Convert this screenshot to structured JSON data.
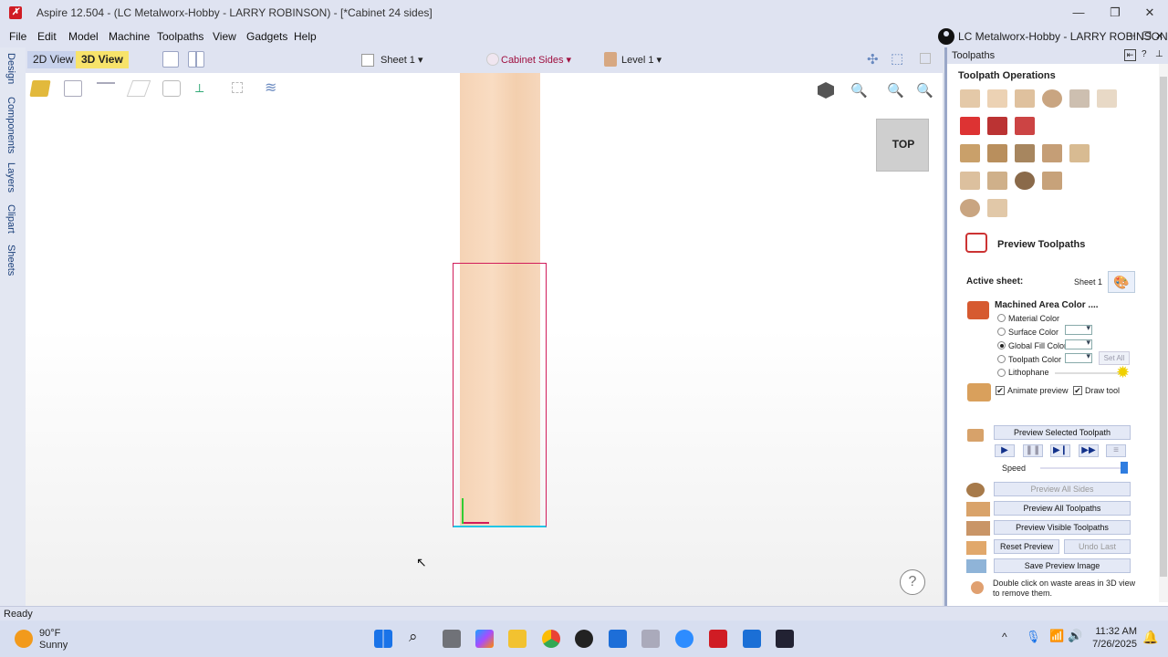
{
  "window": {
    "title": "Aspire 12.504 - (LC Metalworx-Hobby - LARRY ROBINSON) - [*Cabinet 24 sides]",
    "app_icon_glyph": "✗"
  },
  "menu": [
    "File",
    "Edit",
    "Model",
    "Machine",
    "Toolpaths",
    "View",
    "Gadgets",
    "Help"
  ],
  "account": {
    "name": "LC Metalworx-Hobby - LARRY ROBINSON"
  },
  "left_tabs": [
    "Design",
    "Components",
    "Layers",
    "Clipart",
    "Sheets"
  ],
  "view_tabs": {
    "tab_2d": "2D View",
    "tab_3d": "3D View"
  },
  "view_dropdowns": {
    "sheet": "Sheet 1",
    "side": "Cabinet Sides",
    "level": "Level 1"
  },
  "canvas": {
    "view_cube_label": "TOP",
    "help_glyph": "?",
    "cursor_glyph": "↖"
  },
  "panel": {
    "title": "Toolpaths",
    "operations_heading": "Toolpath Operations",
    "preview_heading": "Preview Toolpaths",
    "active_sheet_label": "Active sheet:",
    "active_sheet_value": "Sheet 1",
    "machined_area_heading": "Machined Area Color ....",
    "color_options": [
      "Material Color",
      "Surface Color",
      "Global Fill Color",
      "Toolpath Color",
      "Lithophane"
    ],
    "selected_color_option": "Global Fill Color",
    "set_all_label": "Set All",
    "animate_preview_label": "Animate preview",
    "draw_tool_label": "Draw tool",
    "animate_checked": true,
    "draw_tool_checked": true,
    "preview_selected_label": "Preview Selected Toolpath",
    "speed_label": "Speed",
    "speed_value": 1.0,
    "preview_all_sides_label": "Preview All Sides",
    "preview_all_toolpaths_label": "Preview All Toolpaths",
    "preview_visible_label": "Preview Visible Toolpaths",
    "reset_preview_label": "Reset Preview",
    "undo_last_label": "Undo Last",
    "save_image_label": "Save Preview Image",
    "hint_line1": "Double click on waste areas in 3D view",
    "hint_line2": "to remove them."
  },
  "status": {
    "text": "Ready"
  },
  "taskbar": {
    "weather_temp": "90°F",
    "weather_desc": "Sunny",
    "time": "11:32 AM",
    "date": "7/26/2025"
  },
  "colors": {
    "accent_3d_tab": "#f7e36a",
    "selection_outline": "#d11c5a",
    "wood": "#f5d3b5",
    "panel_button": "#e4e9f6",
    "app_red": "#d01c24"
  }
}
